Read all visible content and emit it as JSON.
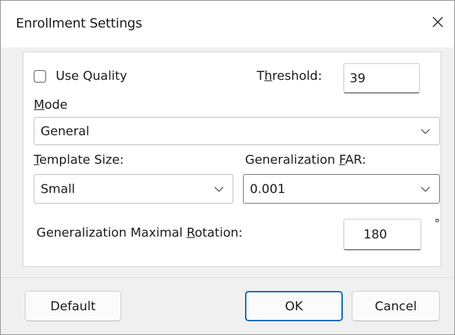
{
  "dialog": {
    "title": "Enrollment Settings"
  },
  "options": {
    "use_quality": {
      "label": "Use Quality",
      "checked": false
    },
    "threshold": {
      "label_pre": "T",
      "label_mn": "h",
      "label_post": "reshold:",
      "value": "39"
    },
    "mode": {
      "label_mn": "M",
      "label_post": "ode",
      "selected": "General"
    },
    "template_size": {
      "label_mn": "T",
      "label_post": "emplate Size:",
      "selected": "Small"
    },
    "generalization_far": {
      "label_pre": "Generalization ",
      "label_mn": "F",
      "label_post": "AR:",
      "selected": "0.001"
    },
    "max_rotation": {
      "label_pre": "Generalization Maximal ",
      "label_mn": "R",
      "label_post": "otation:",
      "value": "180",
      "unit": "°"
    }
  },
  "buttons": {
    "default_label": "Default",
    "ok_label": "OK",
    "cancel_label": "Cancel"
  }
}
